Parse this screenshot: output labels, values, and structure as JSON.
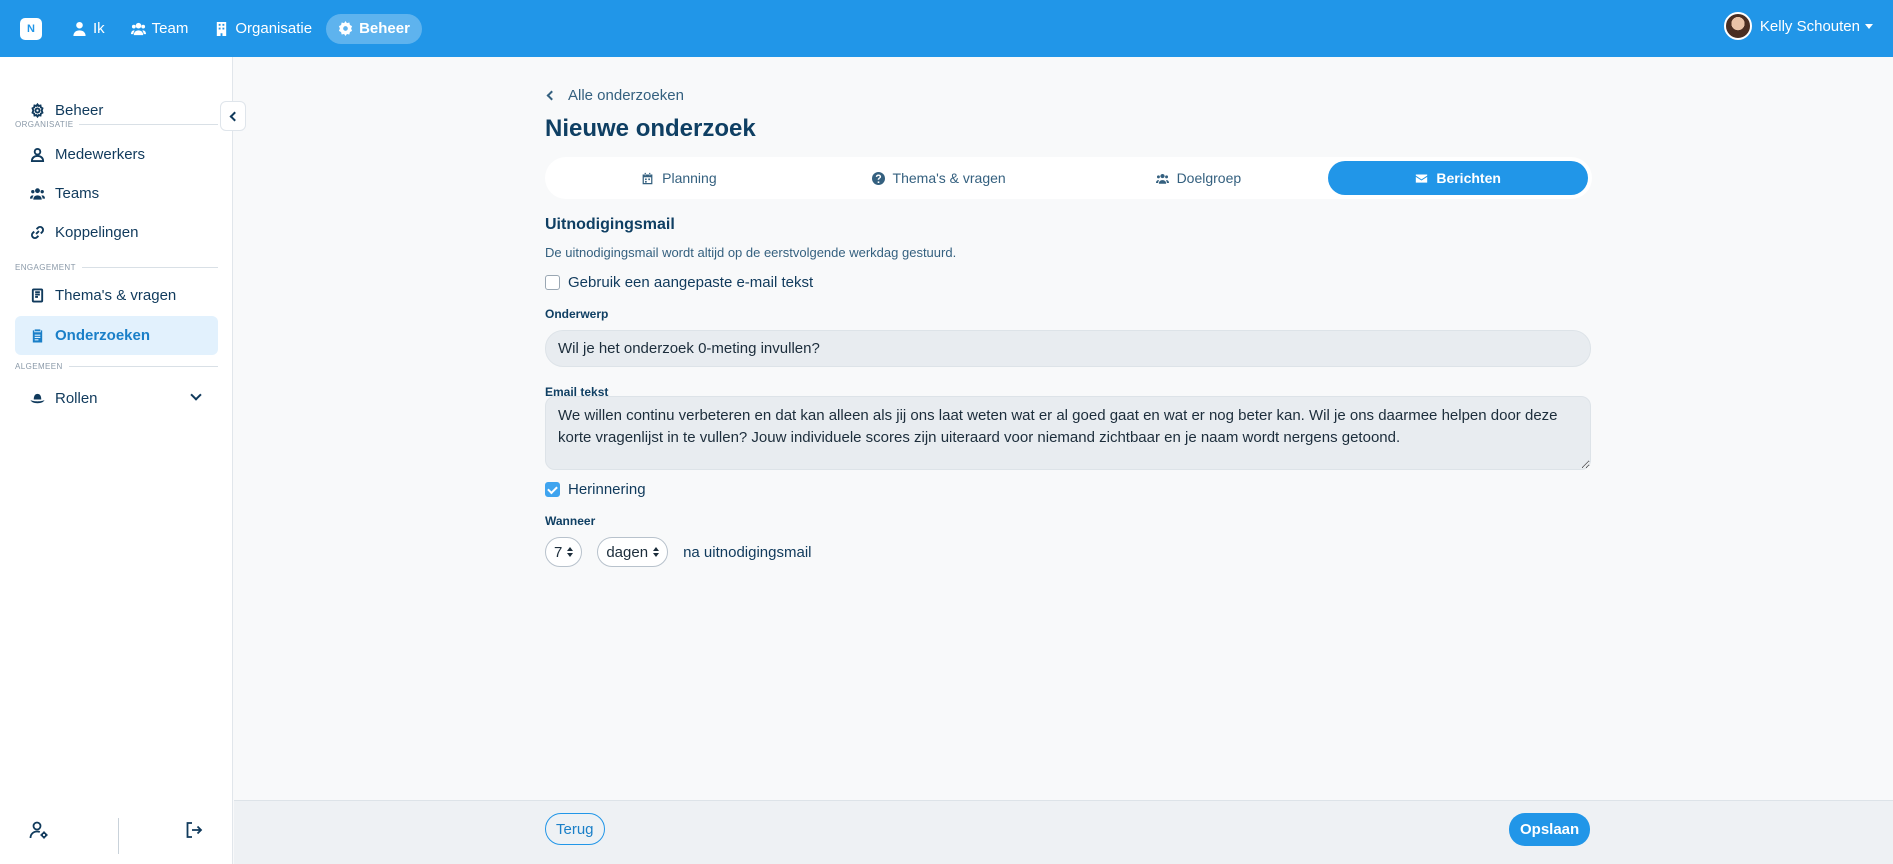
{
  "topbar": {
    "logo": "N",
    "nav": [
      {
        "label": "Ik",
        "icon": "user-icon"
      },
      {
        "label": "Team",
        "icon": "users-icon"
      },
      {
        "label": "Organisatie",
        "icon": "building-icon"
      },
      {
        "label": "Beheer",
        "icon": "gear-icon",
        "active": true
      }
    ],
    "user_name": "Kelly Schouten"
  },
  "sidebar": {
    "top_item": "Beheer",
    "sections": [
      "ORGANISATIE",
      "ENGAGEMENT",
      "ALGEMEEN"
    ],
    "items": [
      "Medewerkers",
      "Teams",
      "Koppelingen",
      "Thema's & vragen",
      "Onderzoeken",
      "Rollen"
    ],
    "active_item": "Onderzoeken"
  },
  "main": {
    "back_label": "Alle onderzoeken",
    "title": "Nieuwe onderzoek",
    "tabs": [
      {
        "label": "Planning",
        "icon": "calendar-icon"
      },
      {
        "label": "Thema's & vragen",
        "icon": "question-icon"
      },
      {
        "label": "Doelgroep",
        "icon": "users-icon"
      },
      {
        "label": "Berichten",
        "icon": "envelope-icon",
        "active": true
      }
    ],
    "section_title": "Uitnodigingsmail",
    "help_text": "De uitnodigingsmail wordt altijd op de eerstvolgende werkdag gestuurd.",
    "custom_email_label": "Gebruik een aangepaste e-mail tekst",
    "custom_email_checked": false,
    "subject_label": "Onderwerp",
    "subject_value": "Wil je het onderzoek 0-meting invullen?",
    "email_label": "Email tekst",
    "email_value": "We willen continu verbeteren en dat kan alleen als jij ons laat weten wat er al goed gaat en wat er nog beter kan. Wil je ons daarmee helpen door deze korte vragenlijst in te vullen? Jouw individuele scores zijn uiteraard voor niemand zichtbaar en je naam wordt nergens getoond.",
    "reminder_label": "Herinnering",
    "reminder_checked": true,
    "when_label": "Wanneer",
    "when_number": "7",
    "when_unit": "dagen",
    "when_suffix": "na uitnodigingsmail"
  },
  "footer": {
    "back_button": "Terug",
    "save_button": "Opslaan"
  },
  "colors": {
    "primary": "#2196e8",
    "text": "#103a5c",
    "active_bg": "#e2f1fd"
  }
}
